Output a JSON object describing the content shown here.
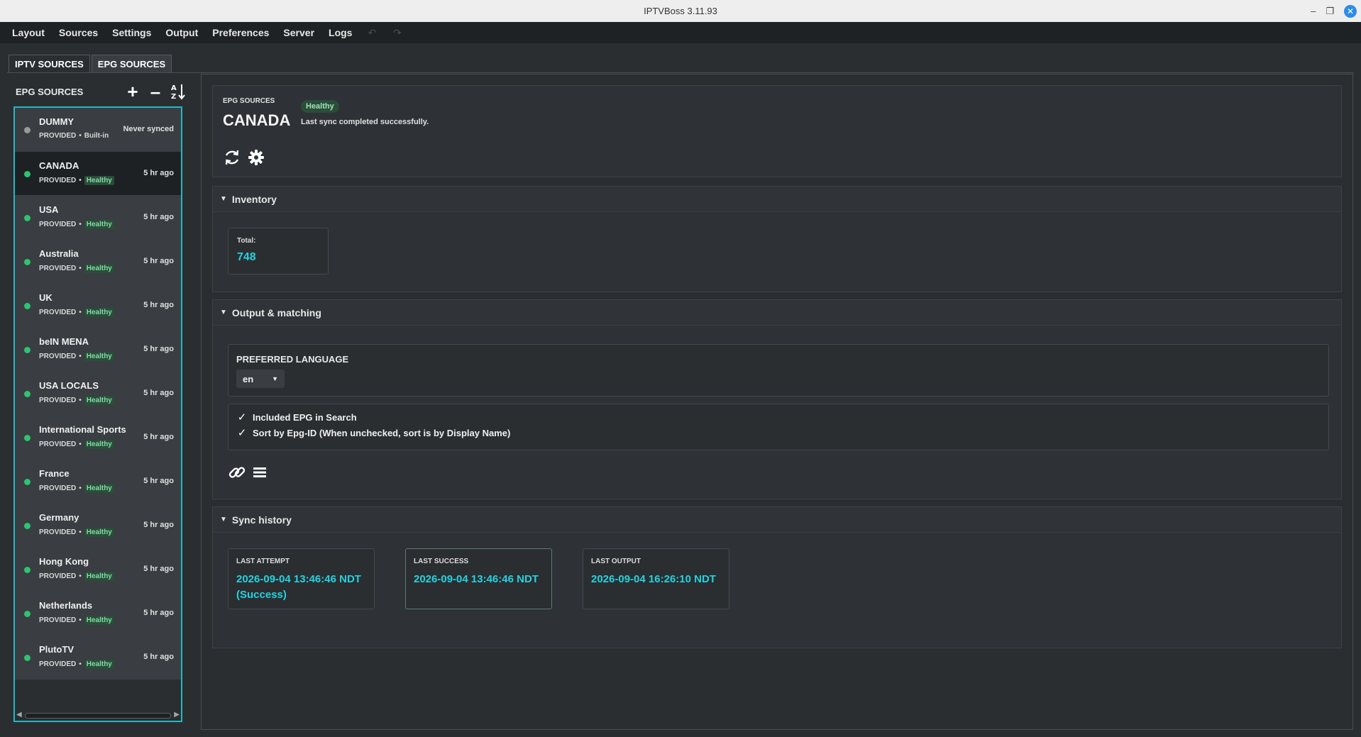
{
  "window": {
    "title": "IPTVBoss 3.11.93"
  },
  "menu": [
    "Layout",
    "Sources",
    "Settings",
    "Output",
    "Preferences",
    "Server",
    "Logs"
  ],
  "tabs": {
    "iptv": "IPTV SOURCES",
    "epg": "EPG SOURCES"
  },
  "left": {
    "title": "EPG SOURCES",
    "items": [
      {
        "name": "DUMMY",
        "type": "PROVIDED",
        "tag": "Built-in",
        "tag_style": "plain",
        "status": "grey",
        "when": "Never synced"
      },
      {
        "name": "CANADA",
        "type": "PROVIDED",
        "tag": "Healthy",
        "tag_style": "health",
        "status": "green",
        "when": "5 hr ago"
      },
      {
        "name": "USA",
        "type": "PROVIDED",
        "tag": "Healthy",
        "tag_style": "health",
        "status": "green",
        "when": "5 hr ago"
      },
      {
        "name": "Australia",
        "type": "PROVIDED",
        "tag": "Healthy",
        "tag_style": "health",
        "status": "green",
        "when": "5 hr ago"
      },
      {
        "name": "UK",
        "type": "PROVIDED",
        "tag": "Healthy",
        "tag_style": "health",
        "status": "green",
        "when": "5 hr ago"
      },
      {
        "name": "beIN MENA",
        "type": "PROVIDED",
        "tag": "Healthy",
        "tag_style": "health",
        "status": "green",
        "when": "5 hr ago"
      },
      {
        "name": "USA LOCALS",
        "type": "PROVIDED",
        "tag": "Healthy",
        "tag_style": "health",
        "status": "green",
        "when": "5 hr ago"
      },
      {
        "name": "International Sports",
        "type": "PROVIDED",
        "tag": "Healthy",
        "tag_style": "health",
        "status": "green",
        "when": "5 hr ago"
      },
      {
        "name": "France",
        "type": "PROVIDED",
        "tag": "Healthy",
        "tag_style": "health",
        "status": "green",
        "when": "5 hr ago"
      },
      {
        "name": "Germany",
        "type": "PROVIDED",
        "tag": "Healthy",
        "tag_style": "health",
        "status": "green",
        "when": "5 hr ago"
      },
      {
        "name": "Hong Kong",
        "type": "PROVIDED",
        "tag": "Healthy",
        "tag_style": "health",
        "status": "green",
        "when": "5 hr ago"
      },
      {
        "name": "Netherlands",
        "type": "PROVIDED",
        "tag": "Healthy",
        "tag_style": "health",
        "status": "green",
        "when": "5 hr ago"
      },
      {
        "name": "PlutoTV",
        "type": "PROVIDED",
        "tag": "Healthy",
        "tag_style": "health",
        "status": "green",
        "when": "5 hr ago"
      }
    ]
  },
  "detail": {
    "small": "EPG SOURCES",
    "title": "CANADA",
    "badge": "Healthy",
    "message": "Last sync completed successfully.",
    "inventory": {
      "heading": "Inventory",
      "total_label": "Total:",
      "total_value": "748"
    },
    "output": {
      "heading": "Output & matching",
      "lang_label": "PREFERRED LANGUAGE",
      "lang_value": "en",
      "check1": "Included EPG in Search",
      "check2": "Sort by Epg-ID (When unchecked, sort is by Display Name)"
    },
    "sync": {
      "heading": "Sync history",
      "attempt_label": "LAST ATTEMPT",
      "attempt_value": "2026-09-04 13:46:46 NDT (Success)",
      "success_label": "LAST SUCCESS",
      "success_value": "2026-09-04 13:46:46 NDT",
      "output_label": "LAST OUTPUT",
      "output_value": "2026-09-04 16:26:10 NDT"
    }
  },
  "colors": {
    "accent": "#22b8c4",
    "value": "#23d3e0",
    "healthy": "#2cc470"
  }
}
